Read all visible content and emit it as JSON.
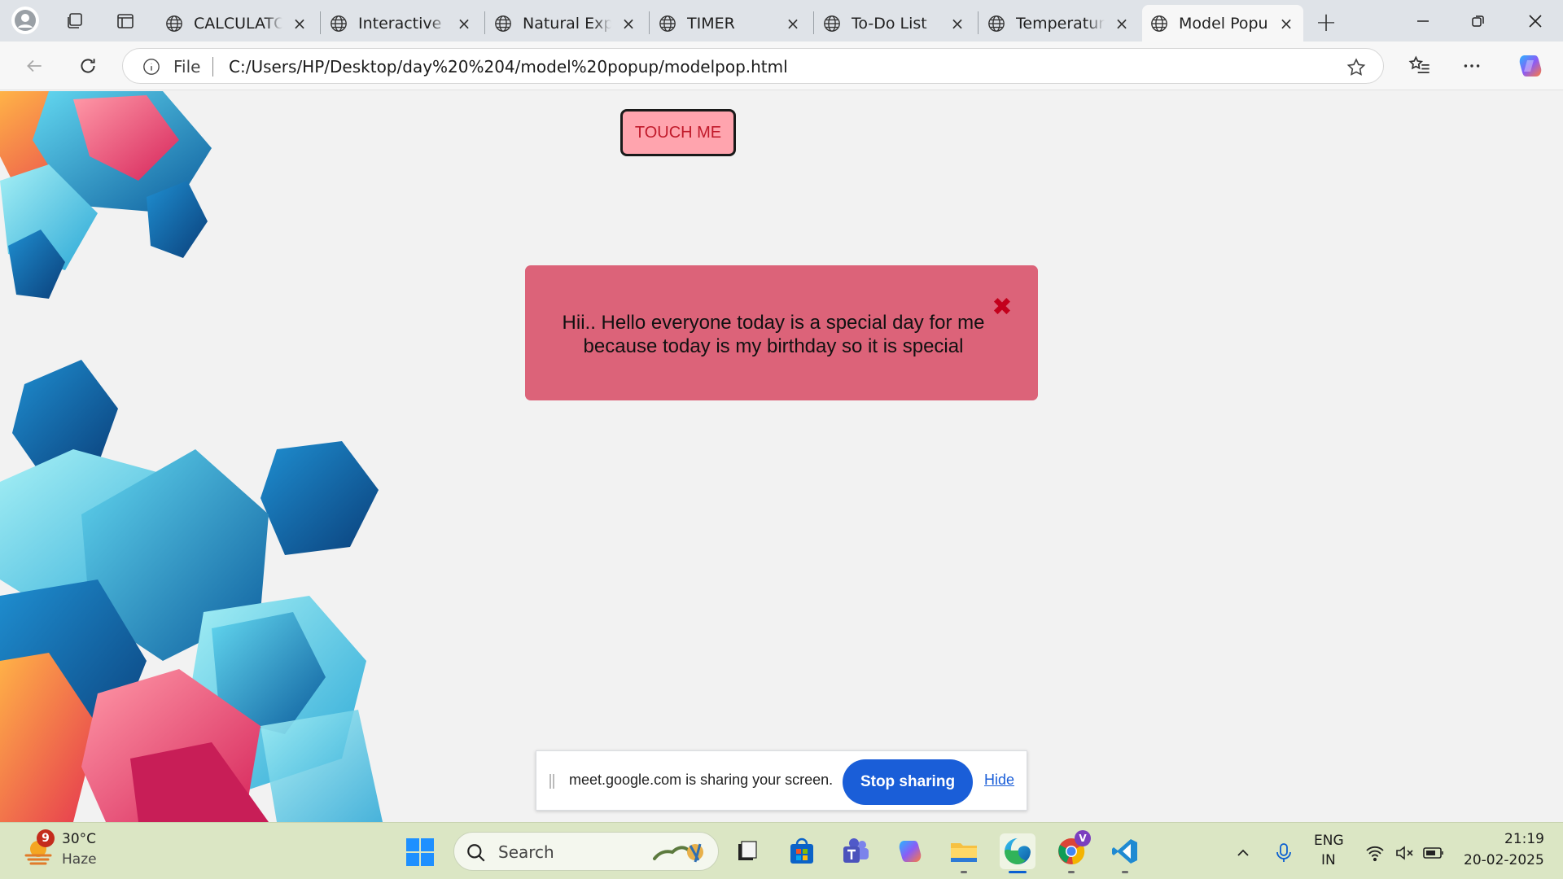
{
  "browser": {
    "tabs": [
      {
        "label": "CALCULATOR",
        "active": false
      },
      {
        "label": "Interactive Co",
        "active": false
      },
      {
        "label": "Natural Explo",
        "active": false
      },
      {
        "label": "TIMER",
        "active": false
      },
      {
        "label": "To-Do List",
        "active": false
      },
      {
        "label": "Temperature C",
        "active": false
      },
      {
        "label": "Model Popup",
        "active": true
      }
    ],
    "close_glyph": "×",
    "new_tab_glyph": "+",
    "address": {
      "scheme_label": "File",
      "url": "C:/Users/HP/Desktop/day%20%204/model%20popup/modelpop.html"
    }
  },
  "page": {
    "touch_button_label": "TOUCH ME",
    "popup": {
      "message": "Hii.. Hello everyone today is a special day for me because today is my birthday so it is special",
      "close_glyph": "✖"
    }
  },
  "screen_share": {
    "message": "meet.google.com is sharing your screen.",
    "stop_label": "Stop sharing",
    "hide_label": "Hide"
  },
  "taskbar": {
    "weather": {
      "badge": "9",
      "temp": "30°C",
      "desc": "Haze"
    },
    "search_label": "Search",
    "language": {
      "line1": "ENG",
      "line2": "IN"
    },
    "clock": {
      "time": "21:19",
      "date": "20-02-2025"
    },
    "chrome_badge": "V"
  },
  "colors": {
    "popup_bg": "#dc6379",
    "touch_button_bg": "#ffa4ae",
    "stop_sharing_bg": "#1a5ed8",
    "taskbar_bg": "#dbe6c4"
  }
}
